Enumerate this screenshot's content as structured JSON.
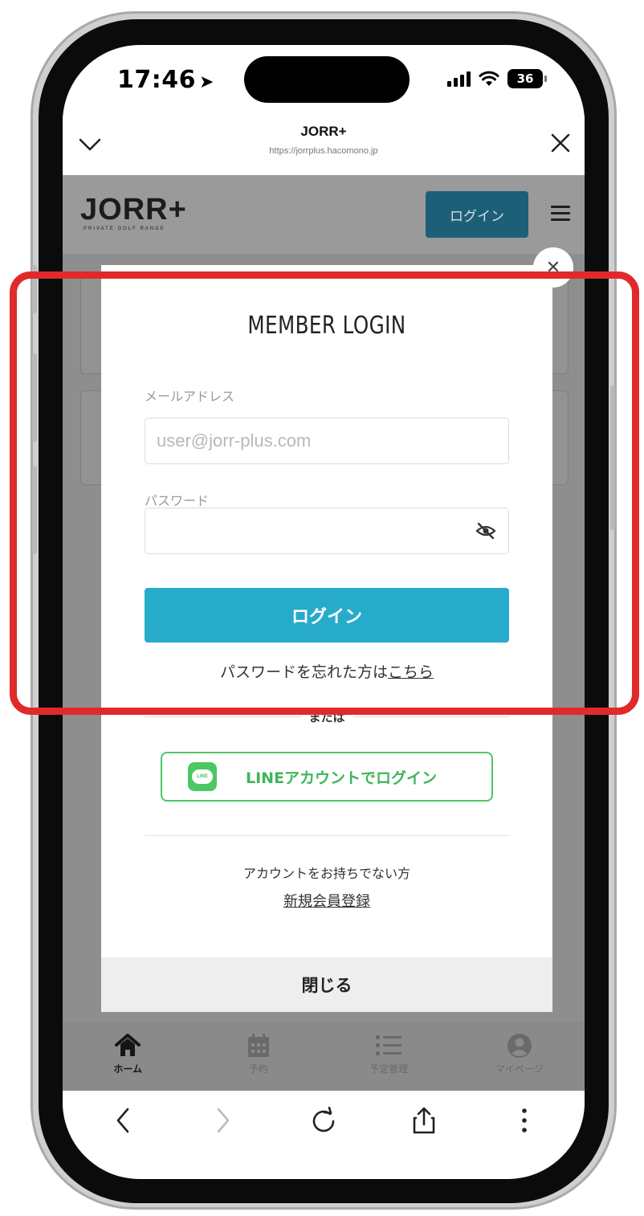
{
  "status_bar": {
    "time": "17:46",
    "battery": "36"
  },
  "browser": {
    "title": "JORR+",
    "url": "https://jorrplus.hacomono.jp"
  },
  "site": {
    "logo": "JORR+",
    "logo_sub": "PRIVATE GOLF RANGE",
    "login_label": "ログイン"
  },
  "modal": {
    "title": "MEMBER LOGIN",
    "email_label": "メールアドレス",
    "email_placeholder": "user@jorr-plus.com",
    "password_label": "パスワード",
    "password_value": "",
    "login_button": "ログイン",
    "forgot_text": "パスワードを忘れた方は",
    "forgot_link": "こちら",
    "or_text": "または",
    "line_login": "LINEアカウントでログイン",
    "line_icon_text": "LINE",
    "no_account_text": "アカウントをお持ちでない方",
    "signup_link": "新規会員登録",
    "close_label": "閉じる"
  },
  "tabs": [
    {
      "label": "ホーム",
      "icon": "home-icon",
      "active": true
    },
    {
      "label": "予約",
      "icon": "calendar-icon",
      "active": false
    },
    {
      "label": "予定管理",
      "icon": "list-icon",
      "active": false
    },
    {
      "label": "マイページ",
      "icon": "user-icon",
      "active": false
    }
  ],
  "colors": {
    "primary_button": "#27abcb",
    "site_login_button": "#1e5f78",
    "line_green": "#4cc764",
    "highlight": "#e02a2a"
  }
}
